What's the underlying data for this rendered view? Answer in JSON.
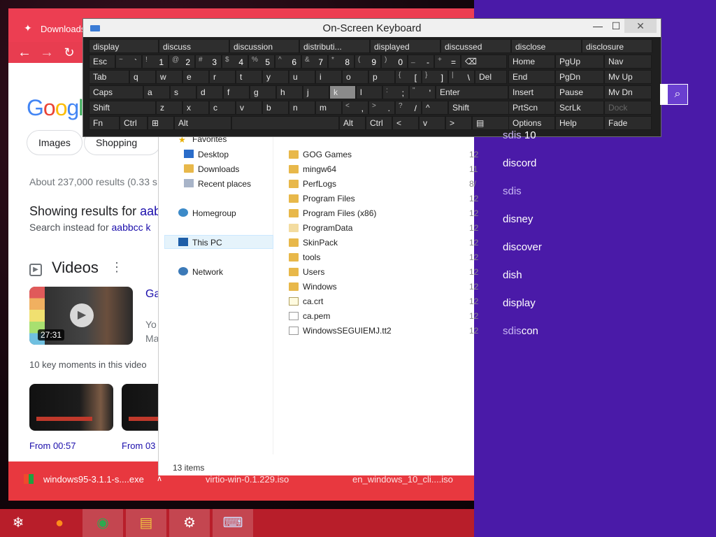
{
  "chrome": {
    "tab_title": "Downloads",
    "google_logo": "Google",
    "chips": [
      "Images",
      "Shopping"
    ],
    "results_count": "About 237,000 results (0.33 s",
    "showing_prefix": "Showing results for ",
    "showing_link": "aab",
    "instead_prefix": "Search instead for ",
    "instead_link": "aabbcc k",
    "videos_heading": "Videos",
    "video": {
      "duration": "27:31",
      "title": "Ga",
      "meta1": "Yo",
      "meta2": "Ma"
    },
    "key_moments": "10 key moments in this video",
    "moments": [
      "From 00:57",
      "From 03"
    ]
  },
  "downloads": [
    {
      "name": "windows95-3.1.1-s....exe"
    },
    {
      "name": "virtio-win-0.1.229.iso"
    },
    {
      "name": "en_windows_10_cli....iso"
    }
  ],
  "explorer": {
    "nav": {
      "favorites": "Favorites",
      "desktop": "Desktop",
      "downloads": "Downloads",
      "recent": "Recent places",
      "homegroup": "Homegroup",
      "thispc": "This PC",
      "network": "Network"
    },
    "files": [
      {
        "name": "GOG Games",
        "type": "folder",
        "date": "12"
      },
      {
        "name": "mingw64",
        "type": "folder",
        "date": "11"
      },
      {
        "name": "PerfLogs",
        "type": "folder",
        "date": "8/"
      },
      {
        "name": "Program Files",
        "type": "folder",
        "date": "12"
      },
      {
        "name": "Program Files (x86)",
        "type": "folder",
        "date": "12"
      },
      {
        "name": "ProgramData",
        "type": "folder-faint",
        "date": "12"
      },
      {
        "name": "SkinPack",
        "type": "folder",
        "date": "12"
      },
      {
        "name": "tools",
        "type": "folder",
        "date": "12"
      },
      {
        "name": "Users",
        "type": "folder",
        "date": "12"
      },
      {
        "name": "Windows",
        "type": "folder",
        "date": "12"
      },
      {
        "name": "ca.crt",
        "type": "cert",
        "date": "12"
      },
      {
        "name": "ca.pem",
        "type": "doc",
        "date": "12"
      },
      {
        "name": "WindowsSEGUIEMJ.tt2",
        "type": "doc",
        "date": "12"
      }
    ],
    "status": "13 items"
  },
  "osk": {
    "title": "On-Screen Keyboard",
    "predictions": [
      "display",
      "discuss",
      "discussion",
      "distributi...",
      "displayed",
      "discussed",
      "disclose",
      "disclosure"
    ],
    "row1": [
      {
        "main": "Esc"
      },
      {
        "shift": "~",
        "main": "`"
      },
      {
        "shift": "!",
        "main": "1"
      },
      {
        "shift": "@",
        "main": "2"
      },
      {
        "shift": "#",
        "main": "3"
      },
      {
        "shift": "$",
        "main": "4"
      },
      {
        "shift": "%",
        "main": "5"
      },
      {
        "shift": "^",
        "main": "6"
      },
      {
        "shift": "&",
        "main": "7"
      },
      {
        "shift": "*",
        "main": "8"
      },
      {
        "shift": "(",
        "main": "9"
      },
      {
        "shift": ")",
        "main": "0"
      },
      {
        "shift": "_",
        "main": "-"
      },
      {
        "shift": "+",
        "main": "="
      },
      {
        "main": "⌫"
      }
    ],
    "row2": [
      {
        "main": "Tab"
      },
      {
        "main": "q"
      },
      {
        "main": "w"
      },
      {
        "main": "e"
      },
      {
        "main": "r"
      },
      {
        "main": "t"
      },
      {
        "main": "y"
      },
      {
        "main": "u"
      },
      {
        "main": "i"
      },
      {
        "main": "o"
      },
      {
        "main": "p"
      },
      {
        "shift": "{",
        "main": "["
      },
      {
        "shift": "}",
        "main": "]"
      },
      {
        "shift": "|",
        "main": "\\"
      },
      {
        "main": "Del"
      }
    ],
    "row3": [
      {
        "main": "Caps"
      },
      {
        "main": "a"
      },
      {
        "main": "s"
      },
      {
        "main": "d"
      },
      {
        "main": "f"
      },
      {
        "main": "g"
      },
      {
        "main": "h"
      },
      {
        "main": "j"
      },
      {
        "main": "k"
      },
      {
        "main": "l"
      },
      {
        "shift": ":",
        "main": ";"
      },
      {
        "shift": "\"",
        "main": "'"
      },
      {
        "main": "Enter"
      }
    ],
    "row4": [
      {
        "main": "Shift"
      },
      {
        "main": "z"
      },
      {
        "main": "x"
      },
      {
        "main": "c"
      },
      {
        "main": "v"
      },
      {
        "main": "b"
      },
      {
        "main": "n"
      },
      {
        "main": "m"
      },
      {
        "shift": "<",
        "main": ","
      },
      {
        "shift": ">",
        "main": "."
      },
      {
        "shift": "?",
        "main": "/"
      },
      {
        "main": "^"
      },
      {
        "main": "Shift"
      }
    ],
    "row5": [
      {
        "main": "Fn"
      },
      {
        "main": "Ctrl"
      },
      {
        "main": "⊞"
      },
      {
        "main": "Alt"
      },
      {
        "main": ""
      },
      {
        "main": "Alt"
      },
      {
        "main": "Ctrl"
      },
      {
        "main": "<"
      },
      {
        "main": "v"
      },
      {
        "main": ">"
      },
      {
        "main": "▤"
      }
    ],
    "side": [
      [
        "Home",
        "PgUp",
        "Nav"
      ],
      [
        "End",
        "PgDn",
        "Mv Up"
      ],
      [
        "Insert",
        "Pause",
        "Mv Dn"
      ],
      [
        "PrtScn",
        "ScrLk",
        "Dock"
      ],
      [
        "Options",
        "Help",
        "Fade"
      ]
    ]
  },
  "search": {
    "suggestions": [
      {
        "pre": "sdis",
        "rest": " 10"
      },
      {
        "pre": "dis",
        "rest": "cord"
      },
      {
        "pre": "sdis",
        "rest": ""
      },
      {
        "pre": "dis",
        "rest": "ney"
      },
      {
        "pre": "dis",
        "rest": "cover"
      },
      {
        "pre": "dis",
        "rest": "h"
      },
      {
        "pre": "dis",
        "rest": "play"
      },
      {
        "pre": "sdis",
        "rest": "con"
      }
    ]
  },
  "taskbar": {
    "items": [
      "ornament-icon",
      "firefox-icon",
      "chrome-icon",
      "file-explorer-icon",
      "settings-icon",
      "on-screen-keyboard-icon"
    ]
  }
}
